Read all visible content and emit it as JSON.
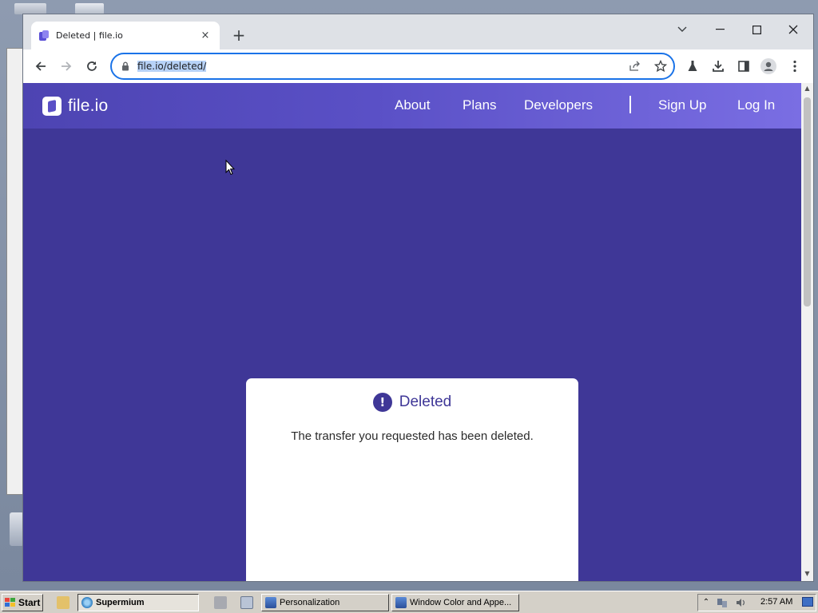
{
  "browser": {
    "tab": {
      "title": "Deleted | file.io",
      "close_glyph": "×"
    },
    "new_tab_glyph": "+",
    "omnibox": {
      "url": "file.io/deleted/"
    }
  },
  "site": {
    "logo_text": "file.io",
    "nav": {
      "about": "About",
      "plans": "Plans",
      "developers": "Developers",
      "sign_up": "Sign Up",
      "log_in": "Log In"
    },
    "card": {
      "icon_glyph": "!",
      "title": "Deleted",
      "message": "The transfer you requested has been deleted."
    },
    "colors": {
      "page_background": "#3f3797",
      "header_gradient_start": "#4d44b2",
      "header_gradient_end": "#7a6ee3",
      "accent": "#3f3797"
    }
  },
  "taskbar": {
    "start_label": "Start",
    "tasks": [
      {
        "label": "Supermium",
        "active": true
      },
      {
        "label": "Personalization",
        "active": false
      },
      {
        "label": "Window Color and Appe...",
        "active": false
      }
    ],
    "clock": "2:57 AM"
  }
}
